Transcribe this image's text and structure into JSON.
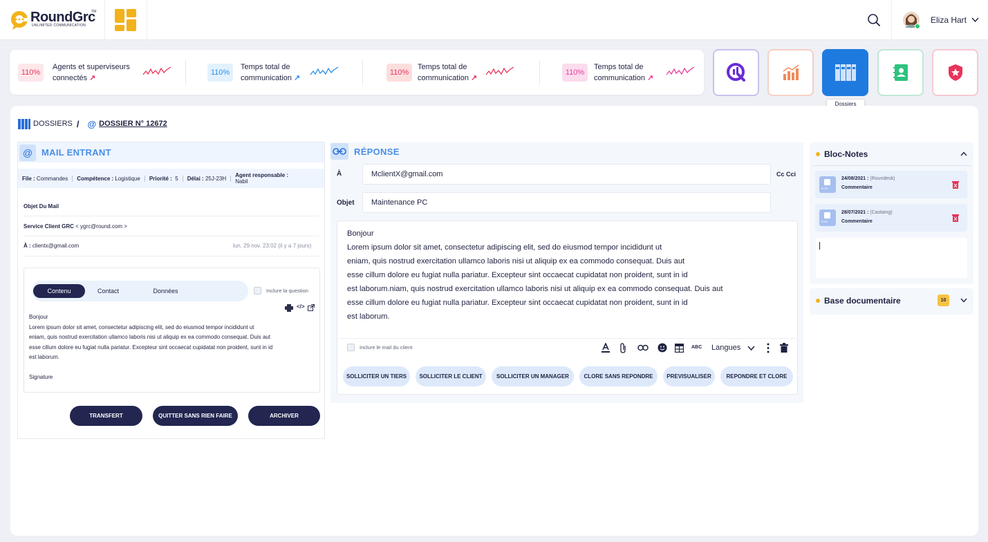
{
  "brand": {
    "name": "RoundGrc",
    "tm": "TM",
    "tagline": "UNLIMITED COMMUNICATION"
  },
  "user": {
    "name": "Eliza Hart"
  },
  "stats": [
    {
      "badge": "110%",
      "label": "Agents et superviseurs connectés",
      "badge_color": "#fde7ea",
      "badge_text": "#e8345a",
      "spark_color": "#e8345a"
    },
    {
      "badge": "110%",
      "label": "Temps total de communication",
      "badge_color": "#e2f1fd",
      "badge_text": "#2b8fe8",
      "spark_color": "#2b8fe8"
    },
    {
      "badge": "110%",
      "label": "Temps total de communication",
      "badge_color": "#fbdede",
      "badge_text": "#e8345a",
      "spark_color": "#e8345a"
    },
    {
      "badge": "110%",
      "label": "Temps total de communication",
      "badge_color": "#fbdcee",
      "badge_text": "#e83c9a",
      "spark_color": "#e83c9a"
    }
  ],
  "tiles": {
    "tooltip": "Dossiers"
  },
  "breadcrumb": {
    "root": "DOSSIERS",
    "sep": "/",
    "current": "DOSSIER N° 12672"
  },
  "mail": {
    "title": "MAIL ENTRANT",
    "meta": {
      "file_k": "File :",
      "file_v": "Commandes",
      "comp_k": "Compétence :",
      "comp_v": "Logistique",
      "prio_k": "Priorité :",
      "prio_v": "5",
      "delai_k": "Délai :",
      "delai_v": "25J-23H",
      "agent_k": "Agent responsable :",
      "agent_v": "Nabil"
    },
    "subject": "Objet Du Mail",
    "from_name": "Service Client GRC",
    "from_email": "< ygrc@round.com >",
    "to_k": "À :",
    "to_v": "clientx@gmail.com",
    "date": "lun. 29 nov. 23:02 (il y a 7 jours)",
    "tabs": [
      "Contenu",
      "Contact",
      "Données"
    ],
    "include_question": "Inclure la question",
    "body": [
      "Bonjour",
      "Lorem ipsum dolor sit amet, consectetur adipiscing elit, sed do eiusmod tempor incididunt ut",
      "eniam, quis nostrud exercitation ullamco laboris nisi ut aliquip ex ea commodo consequat. Duis aut",
      "esse cillum dolore eu fugiat nulla pariatur. Excepteur sint occaecat cupidatat non proident, sunt in  id",
      "est laborum.",
      "",
      "Signature"
    ],
    "buttons": [
      "TRANSFERT",
      "QUITTER SANS RIEN FAIRE",
      "ARCHIVER"
    ]
  },
  "reply": {
    "title": "RÉPONSE",
    "to_label": "À",
    "to_value": "MclientX@gmail.com",
    "cc": "Cc",
    "cci": "Cci",
    "subject_label": "Objet",
    "subject_value": "Maintenance PC",
    "body": [
      "Bonjour",
      "Lorem ipsum dolor sit amet, consectetur adipiscing elit, sed do eiusmod tempor incididunt ut",
      "eniam, quis nostrud exercitation ullamco laboris nisi ut aliquip ex ea commodo consequat. Duis aut",
      "esse cillum dolore eu fugiat nulla pariatur. Excepteur sint occaecat cupidatat non proident, sunt in  id",
      "est laborum.niam, quis nostrud exercitation ullamco laboris nisi ut aliquip ex ea commodo consequat. Duis aut",
      "esse cillum dolore eu fugiat nulla pariatur. Excepteur sint occaecat cupidatat non proident, sunt in  id",
      "est laborum."
    ],
    "include_mail": "Inclure le mail du client",
    "abc": "ABC",
    "langues": "Langues",
    "actions": [
      "SOLLICITER UN TIERS",
      "SOLLICITER LE CLIENT",
      "SOLLICITER UN MANAGER",
      "CLORE SANS REPONDRE",
      "PREVISUALISER",
      "REPONDRE ET CLORE"
    ]
  },
  "notes": {
    "title": "Bloc-Notes",
    "items": [
      {
        "date": "24/08/2021 :",
        "src": "(Roundesk)",
        "label": "Commentaire",
        "time": "11:55"
      },
      {
        "date": "28/07/2021 :",
        "src": "(Castaing)",
        "label": "Commentaire",
        "time": "11:55"
      }
    ]
  },
  "base": {
    "title": "Base documentaire",
    "count": "10"
  }
}
